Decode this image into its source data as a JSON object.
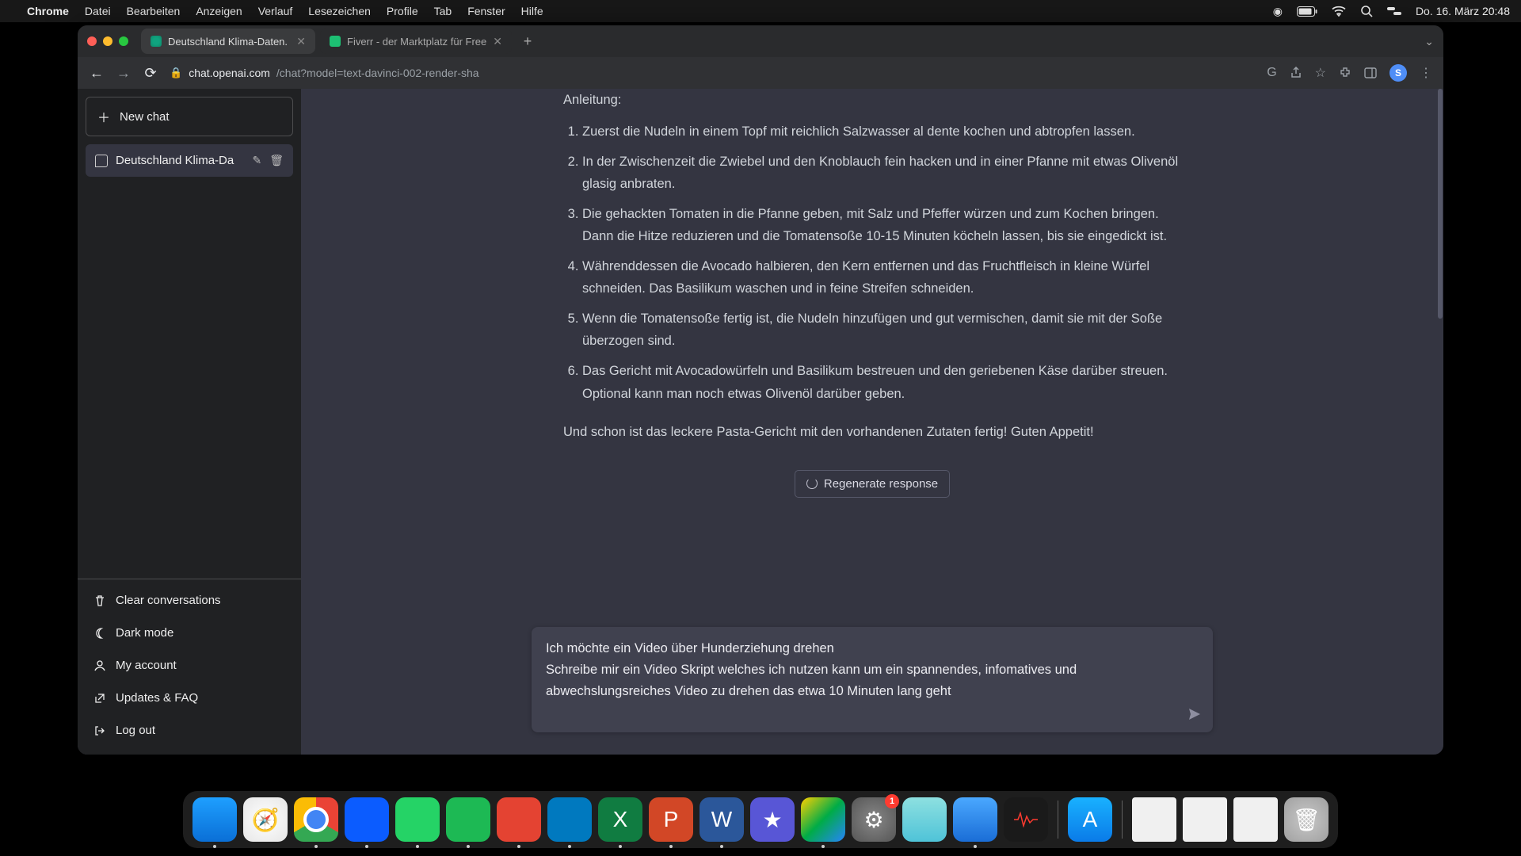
{
  "menubar": {
    "app": "Chrome",
    "items": [
      "Datei",
      "Bearbeiten",
      "Anzeigen",
      "Verlauf",
      "Lesezeichen",
      "Profile",
      "Tab",
      "Fenster",
      "Hilfe"
    ],
    "datetime": "Do. 16. März  20:48"
  },
  "browser": {
    "tabs": [
      {
        "title": "Deutschland Klima-Daten.",
        "active": true
      },
      {
        "title": "Fiverr - der Marktplatz für Free",
        "active": false
      }
    ],
    "url_host": "chat.openai.com",
    "url_path": "/chat?model=text-davinci-002-render-sha",
    "avatar_letter": "S"
  },
  "sidebar": {
    "newchat": "New chat",
    "chats": [
      {
        "title": "Deutschland Klima-Da"
      }
    ],
    "actions": {
      "clear": "Clear conversations",
      "dark": "Dark mode",
      "account": "My account",
      "updates": "Updates & FAQ",
      "logout": "Log out"
    }
  },
  "content": {
    "heading": "Anleitung:",
    "steps": [
      "Zuerst die Nudeln in einem Topf mit reichlich Salzwasser al dente kochen und abtropfen lassen.",
      "In der Zwischenzeit die Zwiebel und den Knoblauch fein hacken und in einer Pfanne mit etwas Olivenöl glasig anbraten.",
      "Die gehackten Tomaten in die Pfanne geben, mit Salz und Pfeffer würzen und zum Kochen bringen. Dann die Hitze reduzieren und die Tomatensoße 10-15 Minuten köcheln lassen, bis sie eingedickt ist.",
      "Währenddessen die Avocado halbieren, den Kern entfernen und das Fruchtfleisch in kleine Würfel schneiden. Das Basilikum waschen und in feine Streifen schneiden.",
      "Wenn die Tomatensoße fertig ist, die Nudeln hinzufügen und gut vermischen, damit sie mit der Soße überzogen sind.",
      "Das Gericht mit Avocadowürfeln und Basilikum bestreuen und den geriebenen Käse darüber streuen. Optional kann man noch etwas Olivenöl darüber geben."
    ],
    "footer": "Und schon ist das leckere Pasta-Gericht mit den vorhandenen Zutaten fertig! Guten Appetit!",
    "regenerate": "Regenerate response",
    "input_value": "Ich möchte ein Video über Hunderziehung drehen\nSchreibe mir ein Video Skript welches ich nutzen kann um ein spannendes, infomatives und abwechslungsreiches Video zu drehen das etwa 10 Minuten lang geht"
  },
  "dock": {
    "settings_badge": "1"
  }
}
